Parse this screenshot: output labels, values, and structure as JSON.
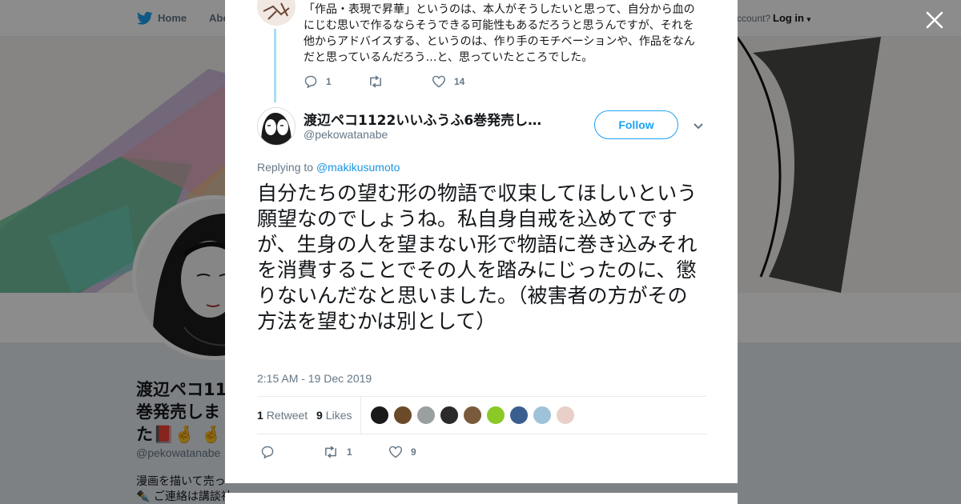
{
  "background_page": {
    "nav": {
      "home_label": "Home",
      "about_label": "Abo",
      "account_prompt": "ccount?",
      "login_label": "Log in"
    },
    "profile": {
      "display_name": "渡辺ペコ1122いいふうふ6巻発売しました📕🤞🤞",
      "display_name_visible": "渡辺ペコ11",
      "display_name_line2": "巻発売しま",
      "display_name_line3": "た📕🤞 🤞",
      "handle": "@pekowatanabe",
      "bio_line1": "漫画を描いて売っ",
      "bio_line2": "✒️ ご連絡は講談社"
    }
  },
  "modal": {
    "close_icon": "close-icon",
    "previous_tweet": {
      "text": "「作品・表現で昇華」というのは、本人がそうしたいと思って、自分から血のにじむ思いで作るならそうできる可能性もあるだろうと思うんですが、それを他からアドバイスする、というのは、作り手のモチベーションや、作品をなんだと思っているんだろう…と、思っていたところでした。",
      "reply_count": "1",
      "retweet_count": "",
      "like_count": "14"
    },
    "tweet": {
      "author_name": "渡辺ペコ1122いいふうふ6巻発売し…",
      "author_handle": "@pekowatanabe",
      "follow_label": "Follow",
      "replying_prefix": "Replying to",
      "replying_to": "@makikusumoto",
      "text": "自分たちの望む形の物語で収束してほしいという願望なのでしょうね。私自身自戒を込めてですが、生身の人を望まない形で物語に巻き込みそれを消費することでその人を踏みにじったのに、懲りないんだなと思いました。（被害者の方がその方法を望むかは別として）",
      "timestamp": "2:15 AM - 19 Dec 2019",
      "retweet_count": "1",
      "retweet_label": "Retweet",
      "like_count": "9",
      "like_label": "Likes",
      "action_reply_count": "",
      "action_retweet_count": "1",
      "action_like_count": "9"
    },
    "liker_colors": [
      "#1a1a1a",
      "#6b4a2a",
      "#9aa0a0",
      "#2a2a2a",
      "#7a5a3a",
      "#8ac926",
      "#3a5f8f",
      "#9ec3d8",
      "#e8d0c8"
    ]
  },
  "colors": {
    "accent": "#1da1f2",
    "link": "#1b95e0",
    "thread": "#aedbf7",
    "muted": "#657786",
    "text": "#14171a"
  }
}
